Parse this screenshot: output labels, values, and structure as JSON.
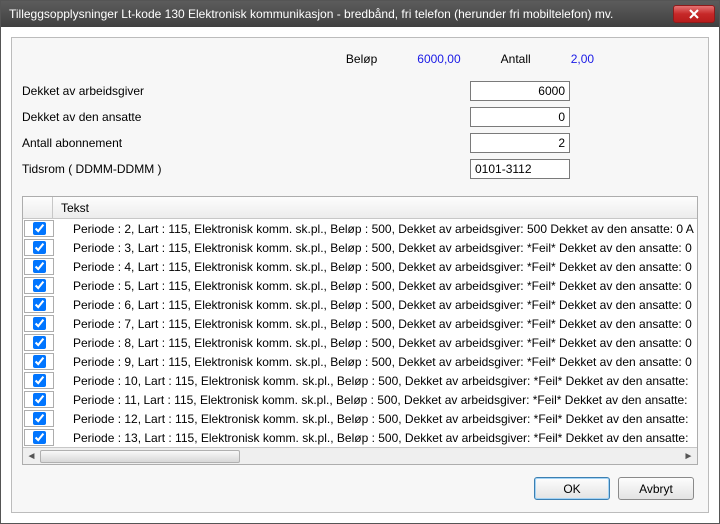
{
  "window": {
    "title": "Tilleggsopplysninger Lt-kode 130 Elektronisk kommunikasjon - bredbånd, fri telefon (herunder fri mobiltelefon) mv."
  },
  "summary": {
    "belop_label": "Beløp",
    "belop_value": "6000,00",
    "antall_label": "Antall",
    "antall_value": "2,00"
  },
  "form": {
    "dekket_arbeidsgiver_label": "Dekket av arbeidsgiver",
    "dekket_arbeidsgiver_value": "6000",
    "dekket_ansatte_label": "Dekket av den ansatte",
    "dekket_ansatte_value": "0",
    "antall_abonnement_label": "Antall abonnement",
    "antall_abonnement_value": "2",
    "tidsrom_label": "Tidsrom ( DDMM-DDMM )",
    "tidsrom_value": "0101-3112"
  },
  "grid": {
    "header_text": "Tekst",
    "rows": [
      {
        "checked": true,
        "text": "Periode : 2, Lart : 115, Elektronisk komm. sk.pl., Beløp : 500,  Dekket av arbeidsgiver: 500 Dekket av den ansatte: 0 A"
      },
      {
        "checked": true,
        "text": "Periode : 3, Lart : 115, Elektronisk komm. sk.pl., Beløp : 500,  Dekket av arbeidsgiver: *Feil* Dekket av den ansatte: 0"
      },
      {
        "checked": true,
        "text": "Periode : 4, Lart : 115, Elektronisk komm. sk.pl., Beløp : 500,  Dekket av arbeidsgiver: *Feil* Dekket av den ansatte: 0"
      },
      {
        "checked": true,
        "text": "Periode : 5, Lart : 115, Elektronisk komm. sk.pl., Beløp : 500,  Dekket av arbeidsgiver: *Feil* Dekket av den ansatte: 0"
      },
      {
        "checked": true,
        "text": "Periode : 6, Lart : 115, Elektronisk komm. sk.pl., Beløp : 500,  Dekket av arbeidsgiver: *Feil* Dekket av den ansatte: 0"
      },
      {
        "checked": true,
        "text": "Periode : 7, Lart : 115, Elektronisk komm. sk.pl., Beløp : 500,  Dekket av arbeidsgiver: *Feil* Dekket av den ansatte: 0"
      },
      {
        "checked": true,
        "text": "Periode : 8, Lart : 115, Elektronisk komm. sk.pl., Beløp : 500,  Dekket av arbeidsgiver: *Feil* Dekket av den ansatte: 0"
      },
      {
        "checked": true,
        "text": "Periode : 9, Lart : 115, Elektronisk komm. sk.pl., Beløp : 500,  Dekket av arbeidsgiver: *Feil* Dekket av den ansatte: 0"
      },
      {
        "checked": true,
        "text": "Periode : 10, Lart : 115, Elektronisk komm. sk.pl., Beløp : 500,  Dekket av arbeidsgiver: *Feil* Dekket av den ansatte:"
      },
      {
        "checked": true,
        "text": "Periode : 11, Lart : 115, Elektronisk komm. sk.pl., Beløp : 500,  Dekket av arbeidsgiver: *Feil* Dekket av den ansatte:"
      },
      {
        "checked": true,
        "text": "Periode : 12, Lart : 115, Elektronisk komm. sk.pl., Beløp : 500,  Dekket av arbeidsgiver: *Feil* Dekket av den ansatte:"
      },
      {
        "checked": true,
        "text": "Periode : 13, Lart : 115, Elektronisk komm. sk.pl., Beløp : 500,  Dekket av arbeidsgiver: *Feil* Dekket av den ansatte:"
      }
    ]
  },
  "buttons": {
    "ok": "OK",
    "cancel": "Avbryt"
  }
}
